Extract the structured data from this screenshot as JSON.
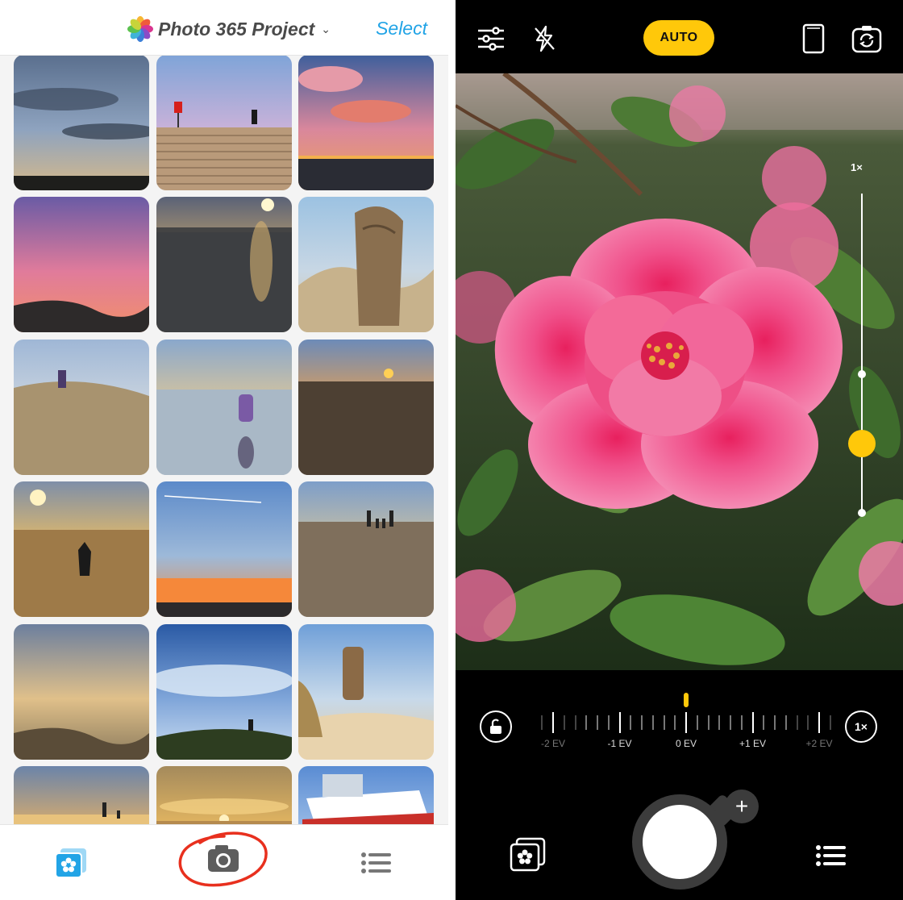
{
  "left_panel": {
    "header": {
      "album_title": "Photo 365 Project",
      "select_label": "Select"
    },
    "tiles": [
      {
        "scene": "cloudy-sky-sunset"
      },
      {
        "scene": "steps-beach-figure"
      },
      {
        "scene": "pink-cloud-sunset"
      },
      {
        "scene": "pink-sky-dunes"
      },
      {
        "scene": "sea-sunset-reflection"
      },
      {
        "scene": "wood-carving-dunes"
      },
      {
        "scene": "child-on-dune"
      },
      {
        "scene": "child-in-water"
      },
      {
        "scene": "beach-sunset-footprints"
      },
      {
        "scene": "child-beach-silhouette"
      },
      {
        "scene": "contrail-sunset"
      },
      {
        "scene": "family-beach-walk"
      },
      {
        "scene": "dune-grass-sunset"
      },
      {
        "scene": "blue-sky-dune-figure"
      },
      {
        "scene": "wood-totem-sand"
      },
      {
        "scene": "sunset-walkers"
      },
      {
        "scene": "golden-sunset"
      },
      {
        "scene": "boat-hull"
      }
    ],
    "tabbar": [
      "albums-icon",
      "camera-icon",
      "list-icon"
    ]
  },
  "right_panel": {
    "top_bar": {
      "settings_icon": "sliders-icon",
      "flash_icon": "flash-off-icon",
      "auto_label": "AUTO",
      "aspect_icon": "aspect-ratio-icon",
      "flip_icon": "camera-flip-icon"
    },
    "zoom": {
      "label": "1×",
      "level": 0.22
    },
    "exposure": {
      "labels": [
        "-2 EV",
        "-1 EV",
        "0 EV",
        "+1 EV",
        "+2 EV"
      ],
      "current_ev": 0
    },
    "ev_reset_label": "1×",
    "colors": {
      "accent": "#ffc80a",
      "link": "#22a4e6"
    }
  }
}
